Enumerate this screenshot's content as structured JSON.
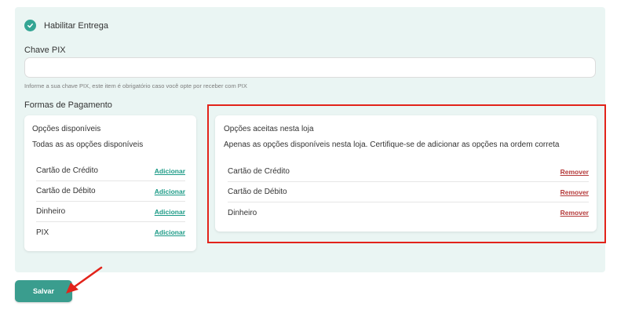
{
  "delivery": {
    "label": "Habilitar Entrega",
    "enabled": true
  },
  "pix": {
    "label": "Chave PIX",
    "value": "",
    "placeholder": "",
    "help": "Informe a sua chave PIX, este item é obrigatório caso você opte por receber com PIX"
  },
  "payments": {
    "label": "Formas de Pagamento",
    "available": {
      "title": "Opções disponíveis",
      "subtitle": "Todas as as opções disponíveis",
      "items": [
        {
          "label": "Cartão de Crédito",
          "action": "Adicionar"
        },
        {
          "label": "Cartão de Débito",
          "action": "Adicionar"
        },
        {
          "label": "Dinheiro",
          "action": "Adicionar"
        },
        {
          "label": "PIX",
          "action": "Adicionar"
        }
      ]
    },
    "accepted": {
      "title": "Opções aceitas nesta loja",
      "subtitle": "Apenas as opções disponíveis nesta loja. Certifique-se de adicionar as opções na ordem correta",
      "items": [
        {
          "label": "Cartão de Crédito",
          "action": "Remover"
        },
        {
          "label": "Cartão de Débito",
          "action": "Remover"
        },
        {
          "label": "Dinheiro",
          "action": "Remover"
        }
      ]
    }
  },
  "save": {
    "label": "Salvar"
  },
  "colors": {
    "accent": "#3a9d8e",
    "panel_bg": "#eaf5f3",
    "add_link": "#1b9a86",
    "remove_link": "#b53b3b",
    "annotation": "#e2231a"
  }
}
